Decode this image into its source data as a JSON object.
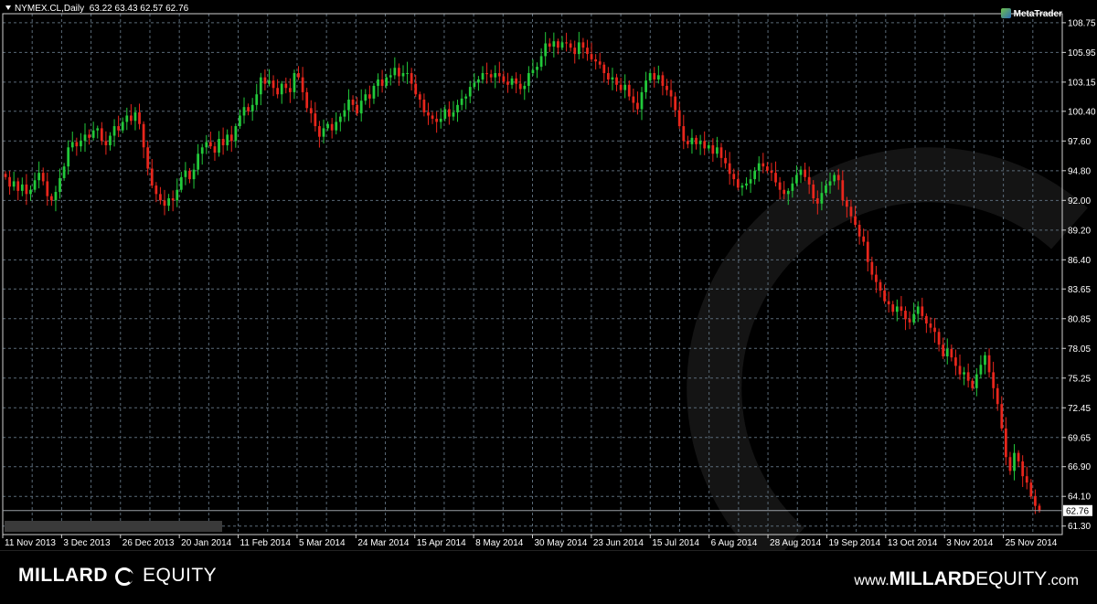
{
  "header": {
    "symbol": "NYMEX.CL,Daily",
    "ohlc": "63.22 63.43 62.57 62.76"
  },
  "logo": {
    "text": "MetaTrader"
  },
  "current_price_label": "62.76",
  "colors": {
    "background": "#000000",
    "grid": "#5a6a78",
    "bull": "#22c93a",
    "bear": "#e8261c",
    "axis_text": "#ffffff"
  },
  "footer": {
    "left_strong": "MILLARD",
    "left_light": "EQUITY",
    "right_prefix": "www.",
    "right_strong": "MILLARD",
    "right_light": "EQUITY",
    "right_suffix": ".com"
  },
  "chart_data": {
    "type": "candlestick",
    "y_ticks": [
      "108.75",
      "105.95",
      "103.15",
      "100.40",
      "97.60",
      "94.80",
      "92.00",
      "89.20",
      "86.40",
      "83.65",
      "80.85",
      "78.05",
      "75.25",
      "72.45",
      "69.65",
      "66.90",
      "64.10",
      "61.30"
    ],
    "x_labels": [
      "11 Nov 2013",
      "3 Dec 2013",
      "26 Dec 2013",
      "20 Jan 2014",
      "11 Feb 2014",
      "5 Mar 2014",
      "24 Mar 2014",
      "15 Apr 2014",
      "8 May 2014",
      "30 May 2014",
      "23 Jun 2014",
      "15 Jul 2014",
      "6 Aug 2014",
      "28 Aug 2014",
      "19 Sep 2014",
      "13 Oct 2014",
      "3 Nov 2014",
      "25 Nov 2014"
    ],
    "ylim": [
      60.5,
      109.6
    ],
    "grid": true,
    "current_price": 62.76,
    "last_ohlc": [
      63.22,
      63.43,
      62.57,
      62.76
    ],
    "closes": [
      94.2,
      93.3,
      93.8,
      92.9,
      93.5,
      92.6,
      93.0,
      93.9,
      94.6,
      93.8,
      92.4,
      92.0,
      92.8,
      94.1,
      95.2,
      97.0,
      97.5,
      97.1,
      97.6,
      98.2,
      97.9,
      98.6,
      98.8,
      97.6,
      97.2,
      98.1,
      99.0,
      98.6,
      99.4,
      100.0,
      99.5,
      100.3,
      99.2,
      97.0,
      95.0,
      93.4,
      92.6,
      92.0,
      91.5,
      92.2,
      92.0,
      93.0,
      94.2,
      94.8,
      94.0,
      94.9,
      96.4,
      97.0,
      97.5,
      97.1,
      96.5,
      97.8,
      97.2,
      98.2,
      97.6,
      99.0,
      100.0,
      100.8,
      100.4,
      101.0,
      102.0,
      103.6,
      103.0,
      103.3,
      102.6,
      102.0,
      103.0,
      102.6,
      102.2,
      104.0,
      103.6,
      102.2,
      100.7,
      100.2,
      99.0,
      98.0,
      98.8,
      99.2,
      98.6,
      99.4,
      99.9,
      100.5,
      101.5,
      101.0,
      100.2,
      101.4,
      102.0,
      101.6,
      102.8,
      103.4,
      102.8,
      103.6,
      103.8,
      104.5,
      103.7,
      104.0,
      104.0,
      103.0,
      102.0,
      101.5,
      100.3,
      100.0,
      99.7,
      99.4,
      99.7,
      100.6,
      99.9,
      100.3,
      101.0,
      101.6,
      101.8,
      102.7,
      103.1,
      103.4,
      104.0,
      103.9,
      103.6,
      104.0,
      103.7,
      103.2,
      102.9,
      103.5,
      103.0,
      102.5,
      102.8,
      104.0,
      104.3,
      104.6,
      105.6,
      106.8,
      106.5,
      107.0,
      106.4,
      106.9,
      106.8,
      106.4,
      105.8,
      106.9,
      106.4,
      105.8,
      105.3,
      105.1,
      104.8,
      104.0,
      103.4,
      103.6,
      102.9,
      102.4,
      102.9,
      101.8,
      101.2,
      100.6,
      102.2,
      103.3,
      104.0,
      103.4,
      103.8,
      102.8,
      102.4,
      101.8,
      100.5,
      99.0,
      97.6,
      97.3,
      97.9,
      97.3,
      97.6,
      96.9,
      97.2,
      96.4,
      97.0,
      96.0,
      95.5,
      94.5,
      94.0,
      93.2,
      93.4,
      93.6,
      94.0,
      94.8,
      95.5,
      95.2,
      94.8,
      94.6,
      93.7,
      93.0,
      92.6,
      92.9,
      93.6,
      94.4,
      94.9,
      94.2,
      93.5,
      92.2,
      91.7,
      92.7,
      93.4,
      93.8,
      94.4,
      93.9,
      92.0,
      91.4,
      90.5,
      89.7,
      88.6,
      88.1,
      86.2,
      85.0,
      84.3,
      83.5,
      82.5,
      82.2,
      81.5,
      82.0,
      81.6,
      80.8,
      80.5,
      81.3,
      82.0,
      81.1,
      80.4,
      80.0,
      79.6,
      78.4,
      77.3,
      78.0,
      77.2,
      76.4,
      75.6,
      75.8,
      75.0,
      74.3,
      75.6,
      76.5,
      77.4,
      75.8,
      74.3,
      72.8,
      70.5,
      67.8,
      66.5,
      68.2,
      67.4,
      66.0,
      65.4,
      64.1,
      63.2,
      62.76
    ]
  }
}
